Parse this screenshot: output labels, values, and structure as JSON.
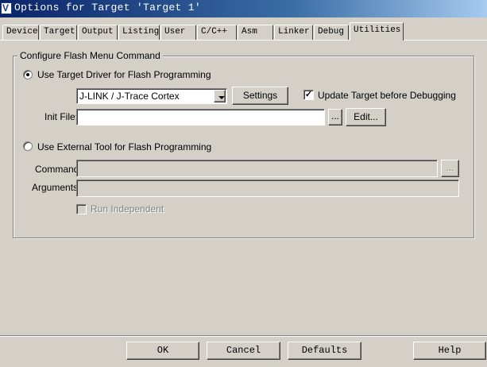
{
  "window": {
    "title": "Options for Target 'Target 1'"
  },
  "tabs": [
    {
      "label": "Device"
    },
    {
      "label": "Target"
    },
    {
      "label": "Output"
    },
    {
      "label": "Listing"
    },
    {
      "label": "User"
    },
    {
      "label": "C/C++"
    },
    {
      "label": "Asm"
    },
    {
      "label": "Linker"
    },
    {
      "label": "Debug"
    },
    {
      "label": "Utilities"
    }
  ],
  "active_tab": "Utilities",
  "group": {
    "label": "Configure Flash Menu Command",
    "target_driver": {
      "label": "Use Target Driver for Flash Programming",
      "selected": true,
      "driver_value": "J-LINK / J-Trace Cortex",
      "settings_button": "Settings",
      "update_checkbox": {
        "label": "Update Target before Debugging",
        "checked": true,
        "mark": "✓"
      },
      "init_file_label": "Init File:",
      "init_file_value": "",
      "browse_button": "...",
      "edit_button": "Edit..."
    },
    "external_tool": {
      "label": "Use External Tool for Flash Programming",
      "selected": false,
      "command_label": "Command:",
      "command_value": "",
      "browse_button": "...",
      "arguments_label": "Arguments:",
      "arguments_value": "",
      "run_independent": {
        "label": "Run Independent",
        "checked": false
      }
    }
  },
  "footer": {
    "ok": "OK",
    "cancel": "Cancel",
    "defaults": "Defaults",
    "help": "Help"
  },
  "colors": {
    "face": "#d4d0c8",
    "title_start": "#0a246a",
    "title_end": "#a6caf0"
  },
  "icons": {
    "app": "keil-uvision-icon"
  }
}
